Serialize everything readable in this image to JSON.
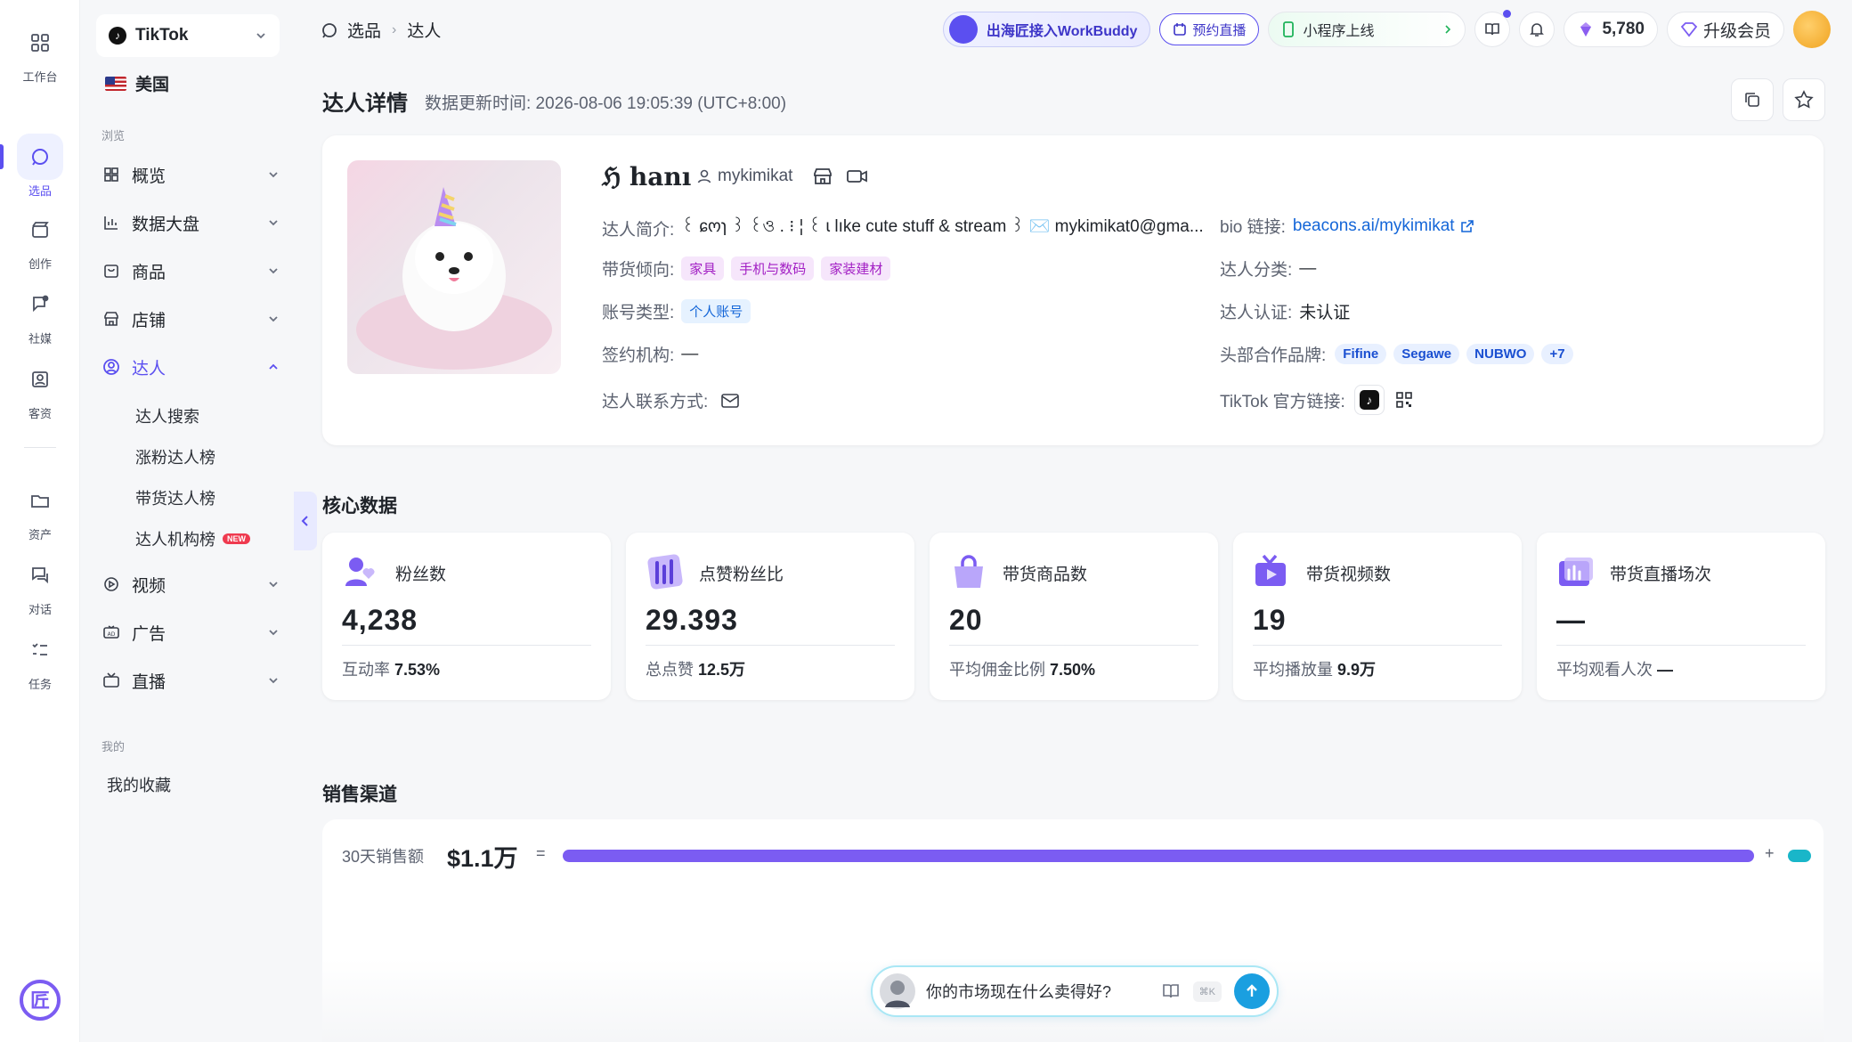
{
  "rail": {
    "items": [
      {
        "label": "工作台",
        "icon": "grid-icon"
      },
      {
        "label": "选品",
        "icon": "chat-bubble-icon"
      },
      {
        "label": "创作",
        "icon": "film-icon"
      },
      {
        "label": "社媒",
        "icon": "social-icon"
      },
      {
        "label": "客资",
        "icon": "contact-card-icon"
      },
      {
        "label": "资产",
        "icon": "folder-icon"
      },
      {
        "label": "对话",
        "icon": "dialog-icon"
      },
      {
        "label": "任务",
        "icon": "task-list-icon"
      }
    ],
    "active": "选品"
  },
  "sidebar": {
    "platform": "TikTok",
    "country": "美国",
    "section_browse": "浏览",
    "nav": [
      {
        "label": "概览"
      },
      {
        "label": "数据大盘"
      },
      {
        "label": "商品"
      },
      {
        "label": "店铺"
      },
      {
        "label": "达人"
      },
      {
        "label": "视频"
      },
      {
        "label": "广告"
      },
      {
        "label": "直播"
      }
    ],
    "sub_items": [
      "达人搜索",
      "涨粉达人榜",
      "带货达人榜",
      "达人机构榜"
    ],
    "new_badge": "NEW",
    "section_mine": "我的",
    "favorites": "我的收藏"
  },
  "breadcrumb": {
    "root": "选品",
    "current": "达人"
  },
  "topbar": {
    "workbuddy": "出海匠接入WorkBuddy",
    "live": "预约直播",
    "miniprogram": "小程序上线",
    "points": "5,780",
    "vip": "升级会员"
  },
  "page": {
    "title": "达人详情",
    "update": "数据更新时间: 2026-08-06 19:05:39   (UTC+8:00)"
  },
  "profile": {
    "nickname": "ℌ hanı",
    "username": "mykimikat",
    "bio_label": "达人简介:",
    "bio": "꒰ ɕოɿ ꒱ ꒰ও . ⁝ ¦ ꒰ ɩ lıke cute stuff & stream ꒱ ✉️ mykimikat0@gma...",
    "bio_link_label": "bio 链接:",
    "bio_link": "beacons.ai/mykimikat",
    "category_label": "带货倾向:",
    "categories": [
      "家具",
      "手机与数码",
      "家装建材"
    ],
    "creator_class_label": "达人分类:",
    "creator_class": "—",
    "account_type_label": "账号类型:",
    "account_type": "个人账号",
    "verify_label": "达人认证:",
    "verify": "未认证",
    "agency_label": "签约机构:",
    "agency": "—",
    "brands_label": "头部合作品牌:",
    "brands": [
      "Fifine",
      "Segawe",
      "NUBWO",
      "+7"
    ],
    "contact_label": "达人联系方式:",
    "tiktok_link_label": "TikTok 官方链接:"
  },
  "core": {
    "title": "核心数据",
    "stats": [
      {
        "label": "粉丝数",
        "value": "4,238",
        "foot_label": "互动率",
        "foot_value": "7.53%"
      },
      {
        "label": "点赞粉丝比",
        "value": "29.393",
        "foot_label": "总点赞",
        "foot_value": "12.5万"
      },
      {
        "label": "带货商品数",
        "value": "20",
        "foot_label": "平均佣金比例",
        "foot_value": "7.50%"
      },
      {
        "label": "带货视频数",
        "value": "19",
        "foot_label": "平均播放量",
        "foot_value": "9.9万"
      },
      {
        "label": "带货直播场次",
        "value": "—",
        "foot_label": "平均观看人次",
        "foot_value": "—"
      }
    ]
  },
  "sales": {
    "title": "销售渠道",
    "label": "30天销售额",
    "value": "$1.1万",
    "eq": "=",
    "plus": "+",
    "share_main": 0.96,
    "colors": {
      "main": "#7b5cf2",
      "secondary": "#19b6c9"
    }
  },
  "ask": {
    "placeholder": "你的市场现在什么卖得好?",
    "shortcut": "⌘K"
  },
  "colors": {
    "accent": "#5b4ff0"
  }
}
